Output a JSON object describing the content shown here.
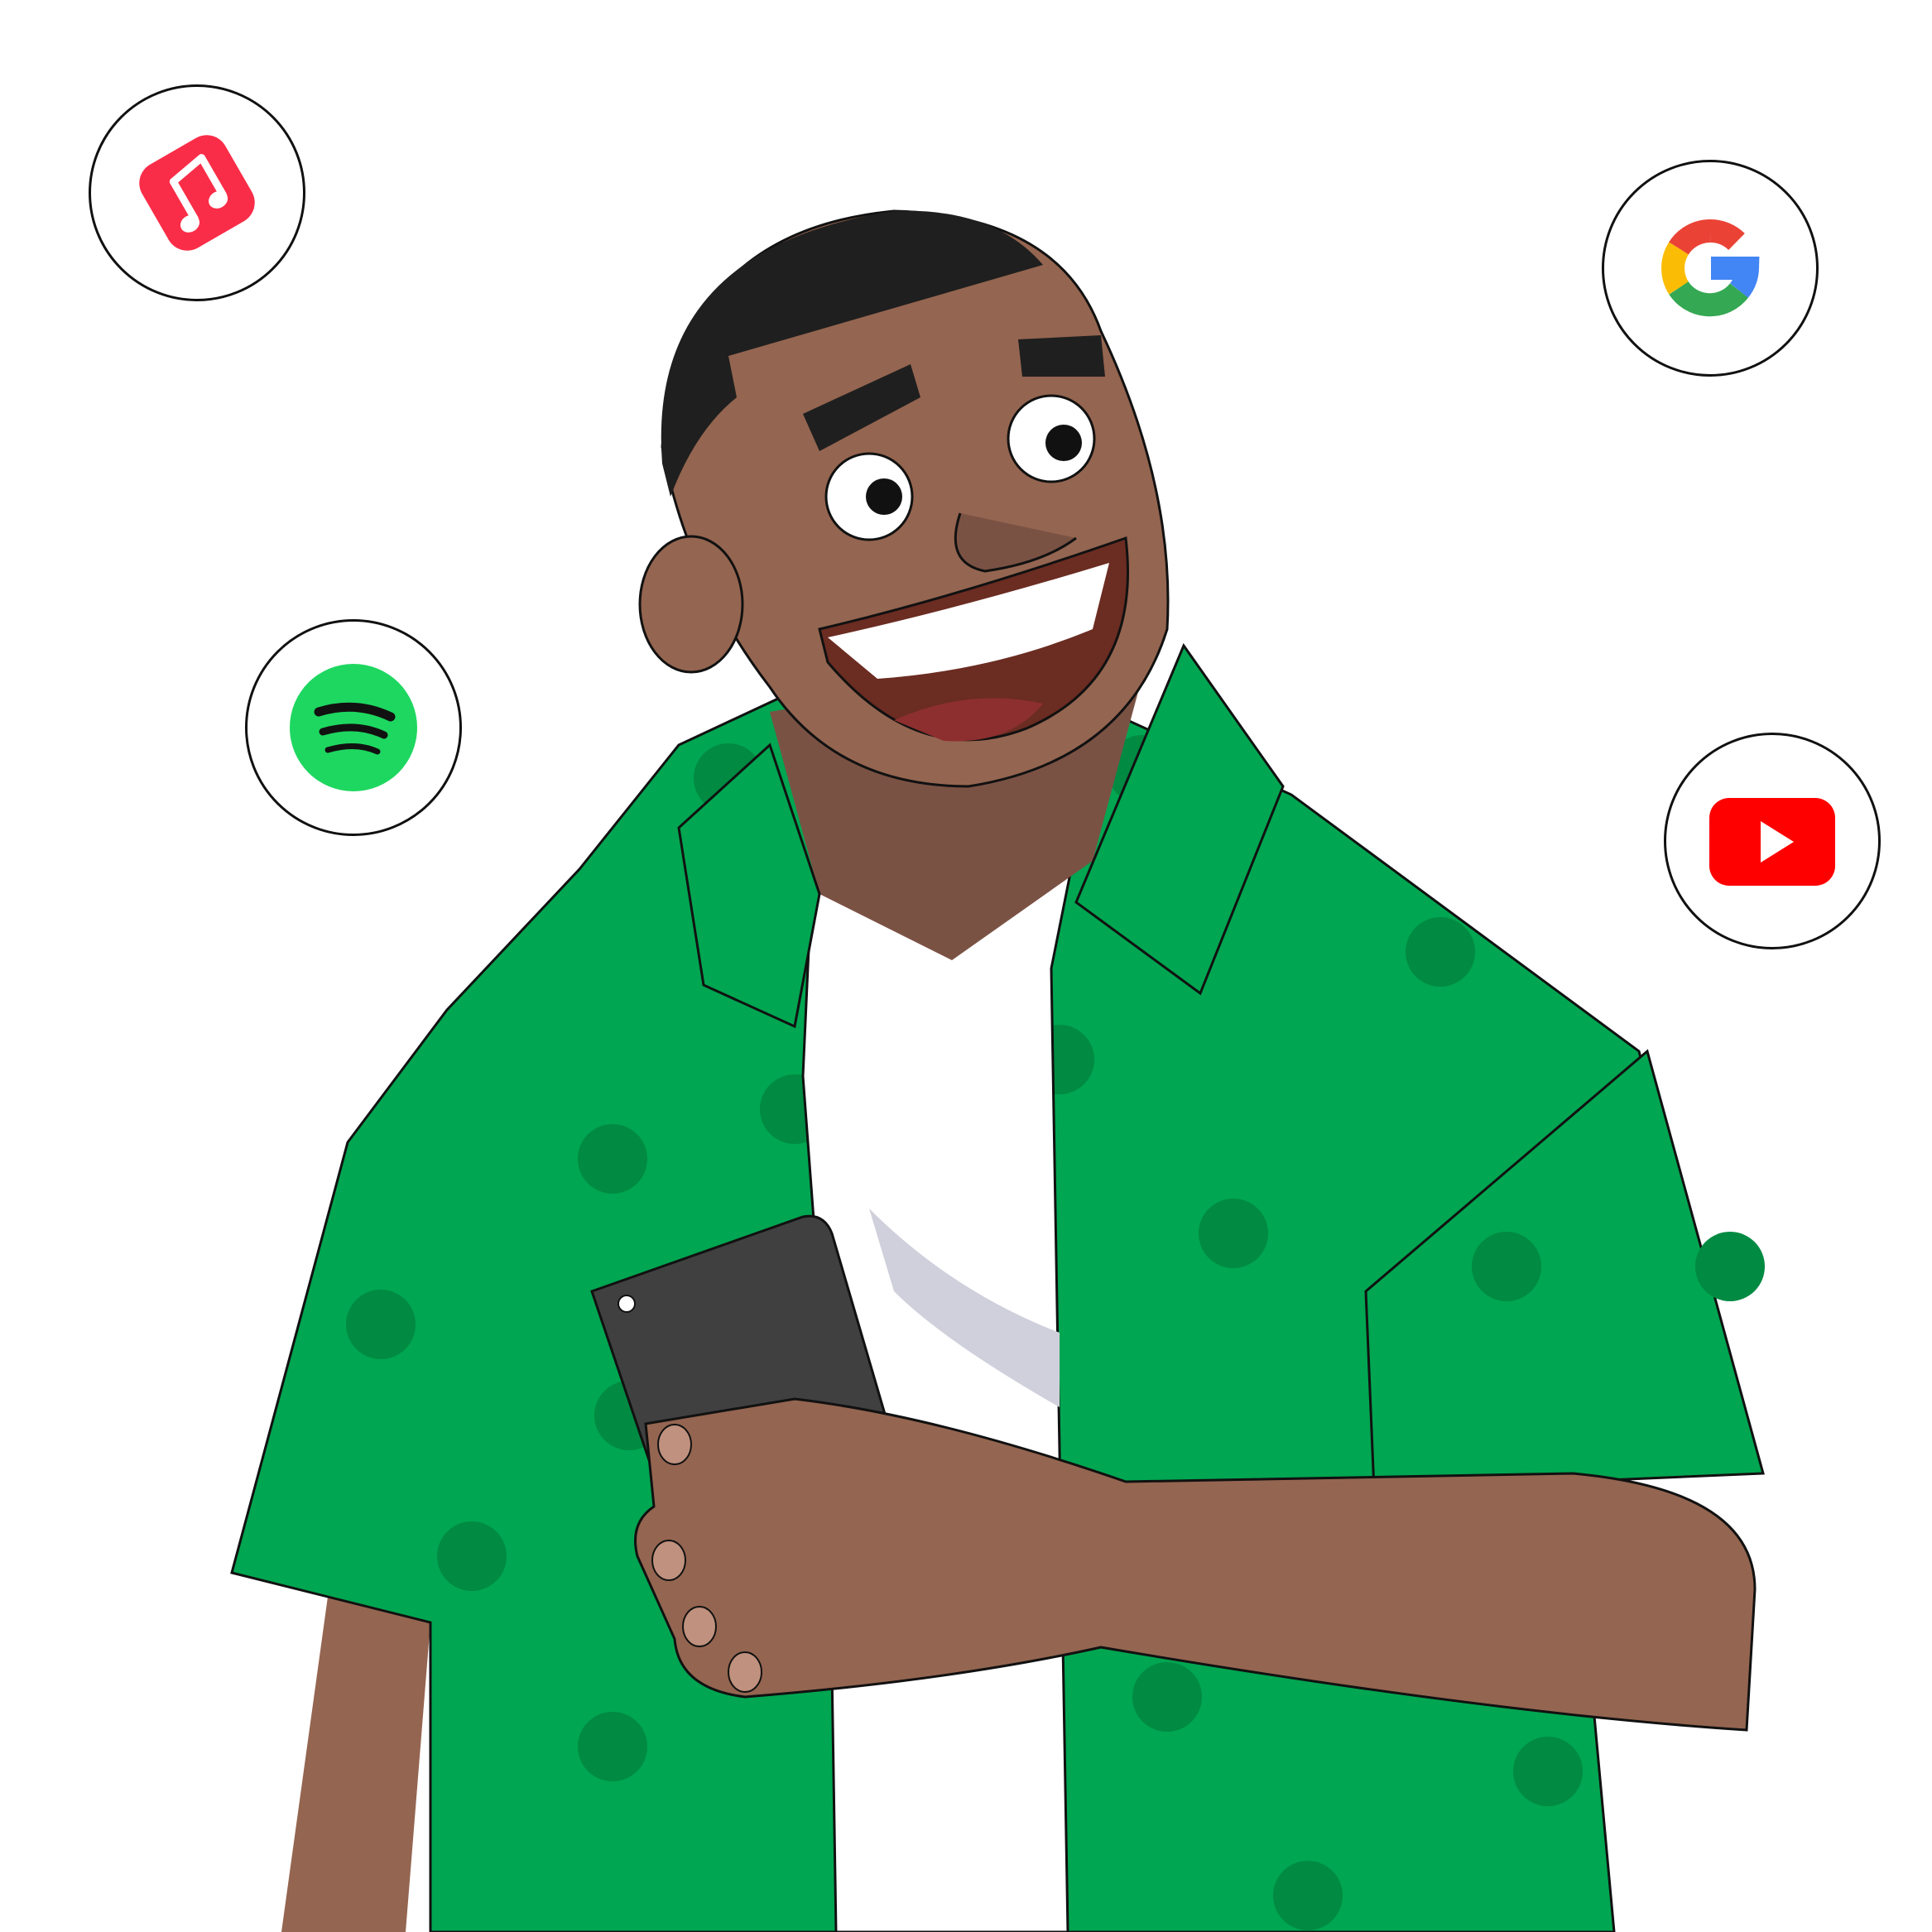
{
  "illustration": {
    "subject": "man-holding-phone",
    "colors": {
      "shirt": "#00a651",
      "shirt_dots": "#008a42",
      "skin": "#946550",
      "skin_shadow": "#7a5244",
      "undershirt": "#ffffff",
      "phone": "#404040"
    }
  },
  "app_icons": [
    {
      "name": "apple-music-icon",
      "color": "#fa2d48"
    },
    {
      "name": "spotify-icon",
      "color": "#1ed760"
    },
    {
      "name": "google-icon",
      "colors": [
        "#ea4335",
        "#fbbc05",
        "#34a853",
        "#4285f4"
      ]
    },
    {
      "name": "youtube-icon",
      "color": "#ff0000"
    }
  ]
}
